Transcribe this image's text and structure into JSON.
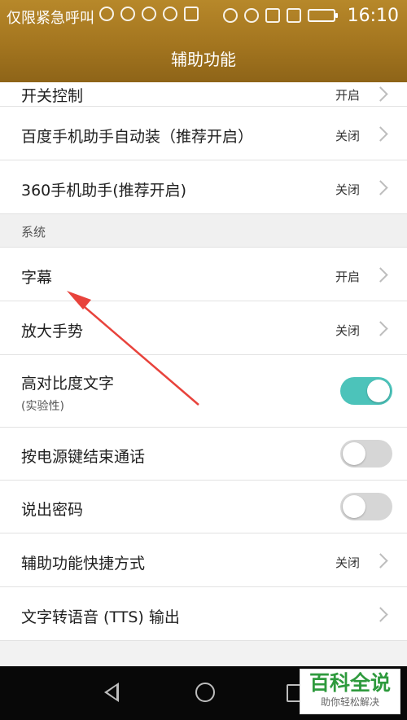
{
  "status_bar": {
    "carrier": "仅限紧急呼叫",
    "time": "16:10"
  },
  "header": {
    "title": "辅助功能"
  },
  "rows": [
    {
      "label": "开关控制",
      "value": "开启"
    },
    {
      "label": "百度手机助手自动装（推荐开启）",
      "value": "关闭"
    },
    {
      "label": "360手机助手(推荐开启)",
      "value": "关闭"
    }
  ],
  "section": {
    "label": "系统"
  },
  "system_rows": [
    {
      "label": "字幕",
      "value": "开启"
    },
    {
      "label": "放大手势",
      "value": "关闭"
    }
  ],
  "toggle_rows": [
    {
      "label": "高对比度文字",
      "sub": "(实验性)",
      "on": true
    },
    {
      "label": "按电源键结束通话",
      "on": false
    },
    {
      "label": "说出密码",
      "on": false
    }
  ],
  "more_rows": [
    {
      "label": "辅助功能快捷方式",
      "value": "关闭"
    },
    {
      "label": "文字转语音 (TTS) 输出"
    }
  ],
  "watermark": {
    "title": "百科全说",
    "subtitle": "助你轻松解决"
  },
  "colors": {
    "header": "#a3751f",
    "toggle_on": "#4cc3ba",
    "annotation_arrow": "#e8433c"
  }
}
